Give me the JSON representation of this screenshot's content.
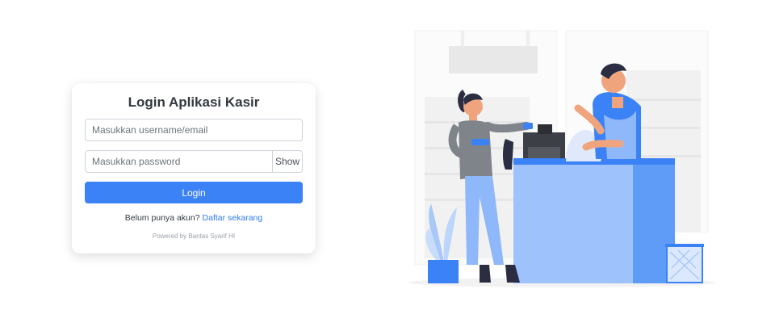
{
  "login": {
    "title": "Login Aplikasi Kasir",
    "username_placeholder": "Masukkan username/email",
    "password_placeholder": "Masukkan password",
    "show_label": "Show",
    "login_label": "Login",
    "register_prompt": "Belum punya akun?",
    "register_link": "Daftar sekarang",
    "powered_by": "Powered by Bantas Syarif HI"
  },
  "colors": {
    "primary": "#3b82f6",
    "link": "#2f7cf6",
    "illustration_blue": "#4a8cf7"
  },
  "illustration": {
    "subject": "cashier-counter-illustration"
  }
}
